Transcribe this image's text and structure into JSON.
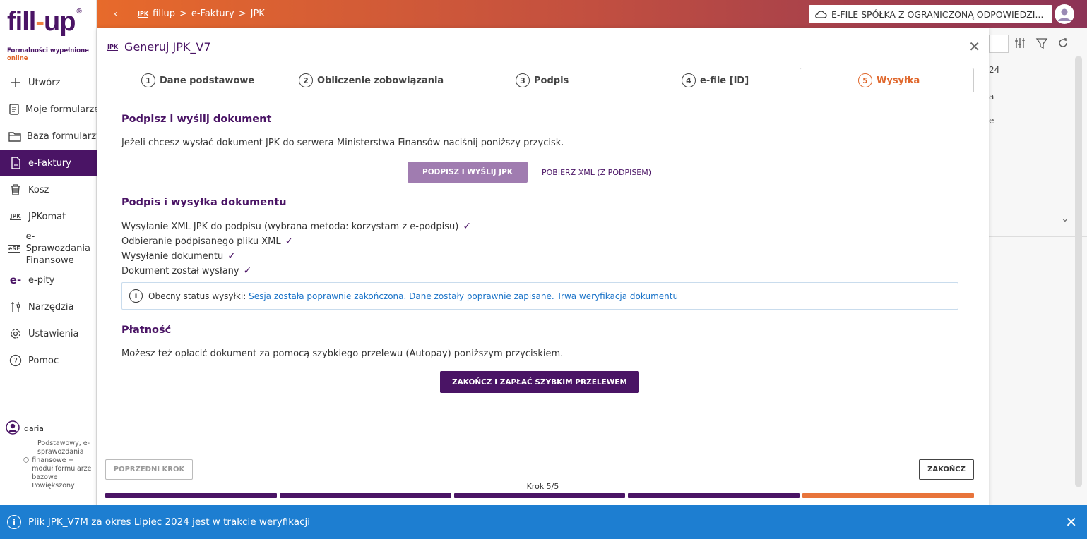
{
  "sidebar": {
    "logo": "fill-up",
    "logo_reg": "®",
    "tagline_a": "Formalności wypełnione ",
    "tagline_b": "online",
    "items": [
      {
        "label": "Utwórz",
        "icon": "plus-icon"
      },
      {
        "label": "Moje formularze",
        "icon": "document-icon"
      },
      {
        "label": "Baza formularzy",
        "icon": "folder-icon"
      },
      {
        "label": "e-Faktury",
        "icon": "invoice-icon",
        "active": true
      },
      {
        "label": "Kosz",
        "icon": "trash-icon"
      },
      {
        "label": "JPKomat",
        "icon": "jpk-icon"
      },
      {
        "label": "e-Sprawozdania Finansowe",
        "icon": "esf-icon"
      },
      {
        "label": "e-pity",
        "icon": "epity-icon"
      },
      {
        "label": "Narzędzia",
        "icon": "tools-icon"
      },
      {
        "label": "Ustawienia",
        "icon": "gear-icon"
      },
      {
        "label": "Pomoc",
        "icon": "help-icon"
      }
    ],
    "user": {
      "name": "daria",
      "plan_a": "Podstawowy, e-sprawozdania",
      "plan_b": "finansowe + moduł formularze bazowe Powiększony"
    }
  },
  "topbar": {
    "crumb_icon": "JPK",
    "crumb_1": "fillup",
    "sep": ">",
    "crumb_2": "e-Faktury",
    "crumb_3": "JPK",
    "company": "E-FILE SPÓŁKA Z OGRANICZONĄ ODPOWIEDZI..."
  },
  "background": {
    "year": "24",
    "t1": "a",
    "t2": "e"
  },
  "modal": {
    "title_icon": "JPK",
    "title": "Generuj JPK_V7",
    "tabs": [
      {
        "num": "1",
        "label": "Dane podstawowe"
      },
      {
        "num": "2",
        "label": "Obliczenie zobowiązania"
      },
      {
        "num": "3",
        "label": "Podpis"
      },
      {
        "num": "4",
        "label": "e-file [ID]"
      },
      {
        "num": "5",
        "label": "Wysyłka"
      }
    ],
    "sign_section": {
      "title": "Podpisz i wyślij dokument",
      "desc": "Jeżeli chcesz wysłać dokument JPK do serwera Ministerstwa Finansów naciśnij poniższy przycisk.",
      "sign_button": "PODPISZ I WYŚLIJ JPK",
      "download_link": "POBIERZ XML (Z PODPISEM)"
    },
    "process_section": {
      "title": "Podpis i wysyłka dokumentu",
      "steps": [
        "Wysyłanie XML JPK do podpisu (wybrana metoda: korzystam z e-podpisu)",
        "Odbieranie podpisanego pliku XML",
        "Wysyłanie dokumentu",
        "Dokument został wysłany"
      ],
      "status_label": "Obecny status wysyłki:",
      "status_value": "Sesja została poprawnie zakończona. Dane zostały poprawnie zapisane. Trwa weryfikacja dokumentu"
    },
    "payment_section": {
      "title": "Płatność",
      "desc": "Możesz też opłacić dokument za pomocą szybkiego przelewu (Autopay) poniższym przyciskiem.",
      "pay_button": "ZAKOŃCZ I ZAPŁAĆ SZYBKIM PRZELEWEM"
    },
    "footer": {
      "prev_button": "POPRZEDNI KROK",
      "finish_button": "ZAKOŃCZ",
      "step_text": "Krok 5/5",
      "progress_current": 5,
      "progress_total": 5
    }
  },
  "banner": {
    "text": "Plik JPK_V7M za okres Lipiec 2024 jest w trakcie weryfikacji"
  },
  "colors": {
    "brand_purple": "#4a1465",
    "accent_orange": "#e0682d",
    "banner_blue": "#1d7ed1"
  }
}
